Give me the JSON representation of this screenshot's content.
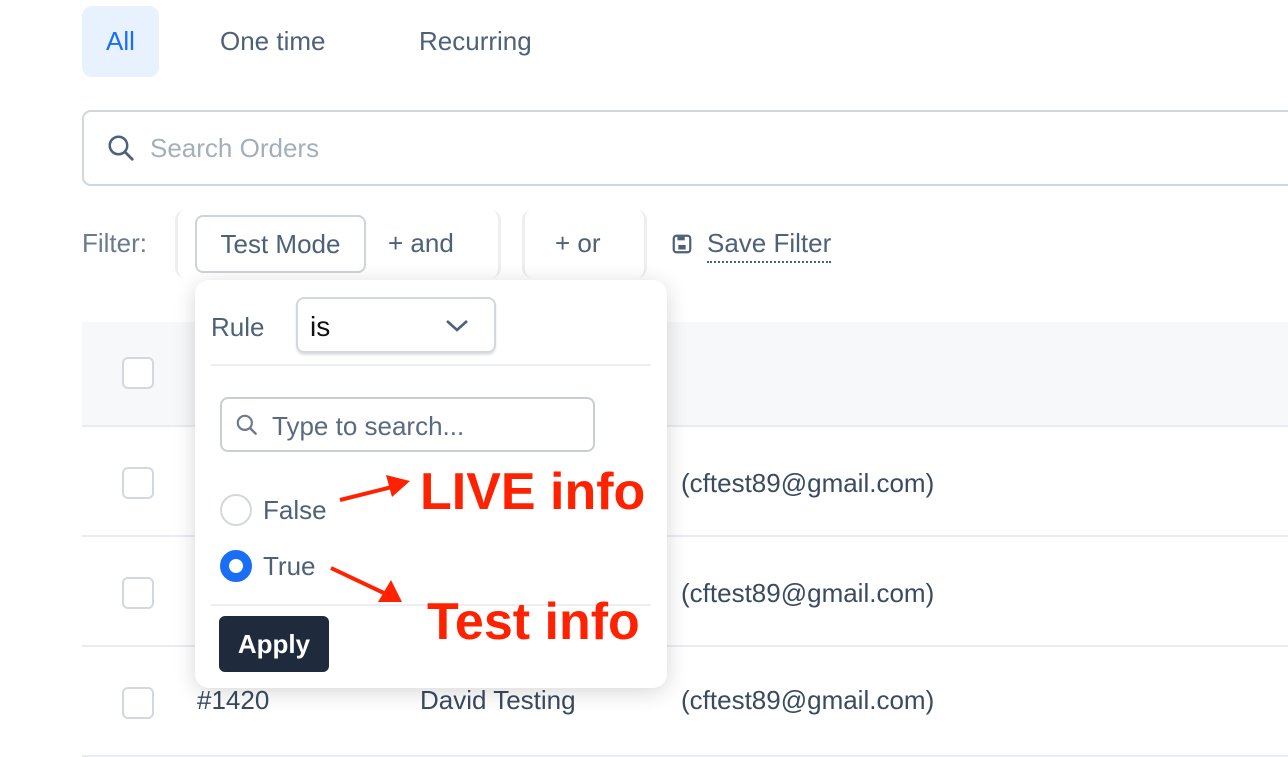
{
  "tabs": [
    {
      "label": "All",
      "active": true
    },
    {
      "label": "One time"
    },
    {
      "label": "Recurring"
    }
  ],
  "search": {
    "placeholder": "Search Orders"
  },
  "filter": {
    "label": "Filter:",
    "chip": "Test Mode",
    "and": "+ and",
    "or": "+ or",
    "save": "Save Filter"
  },
  "popup": {
    "rule_label": "Rule",
    "rule_value": "is",
    "search_placeholder": "Type to search...",
    "options": [
      {
        "label": "False",
        "selected": false
      },
      {
        "label": "True",
        "selected": true
      }
    ],
    "apply": "Apply"
  },
  "rows": [
    {
      "customer": "(cftest89@gmail.com)"
    },
    {
      "customer": "(cftest89@gmail.com)"
    },
    {
      "order": "#1420",
      "name": "David Testing",
      "customer": "(cftest89@gmail.com)"
    }
  ],
  "annotations": {
    "live": "LIVE info",
    "test": "Test info"
  },
  "colors": {
    "accent": "#1a6ef5",
    "annotation": "#ff2200",
    "apply_bg": "#1f2a3c"
  }
}
